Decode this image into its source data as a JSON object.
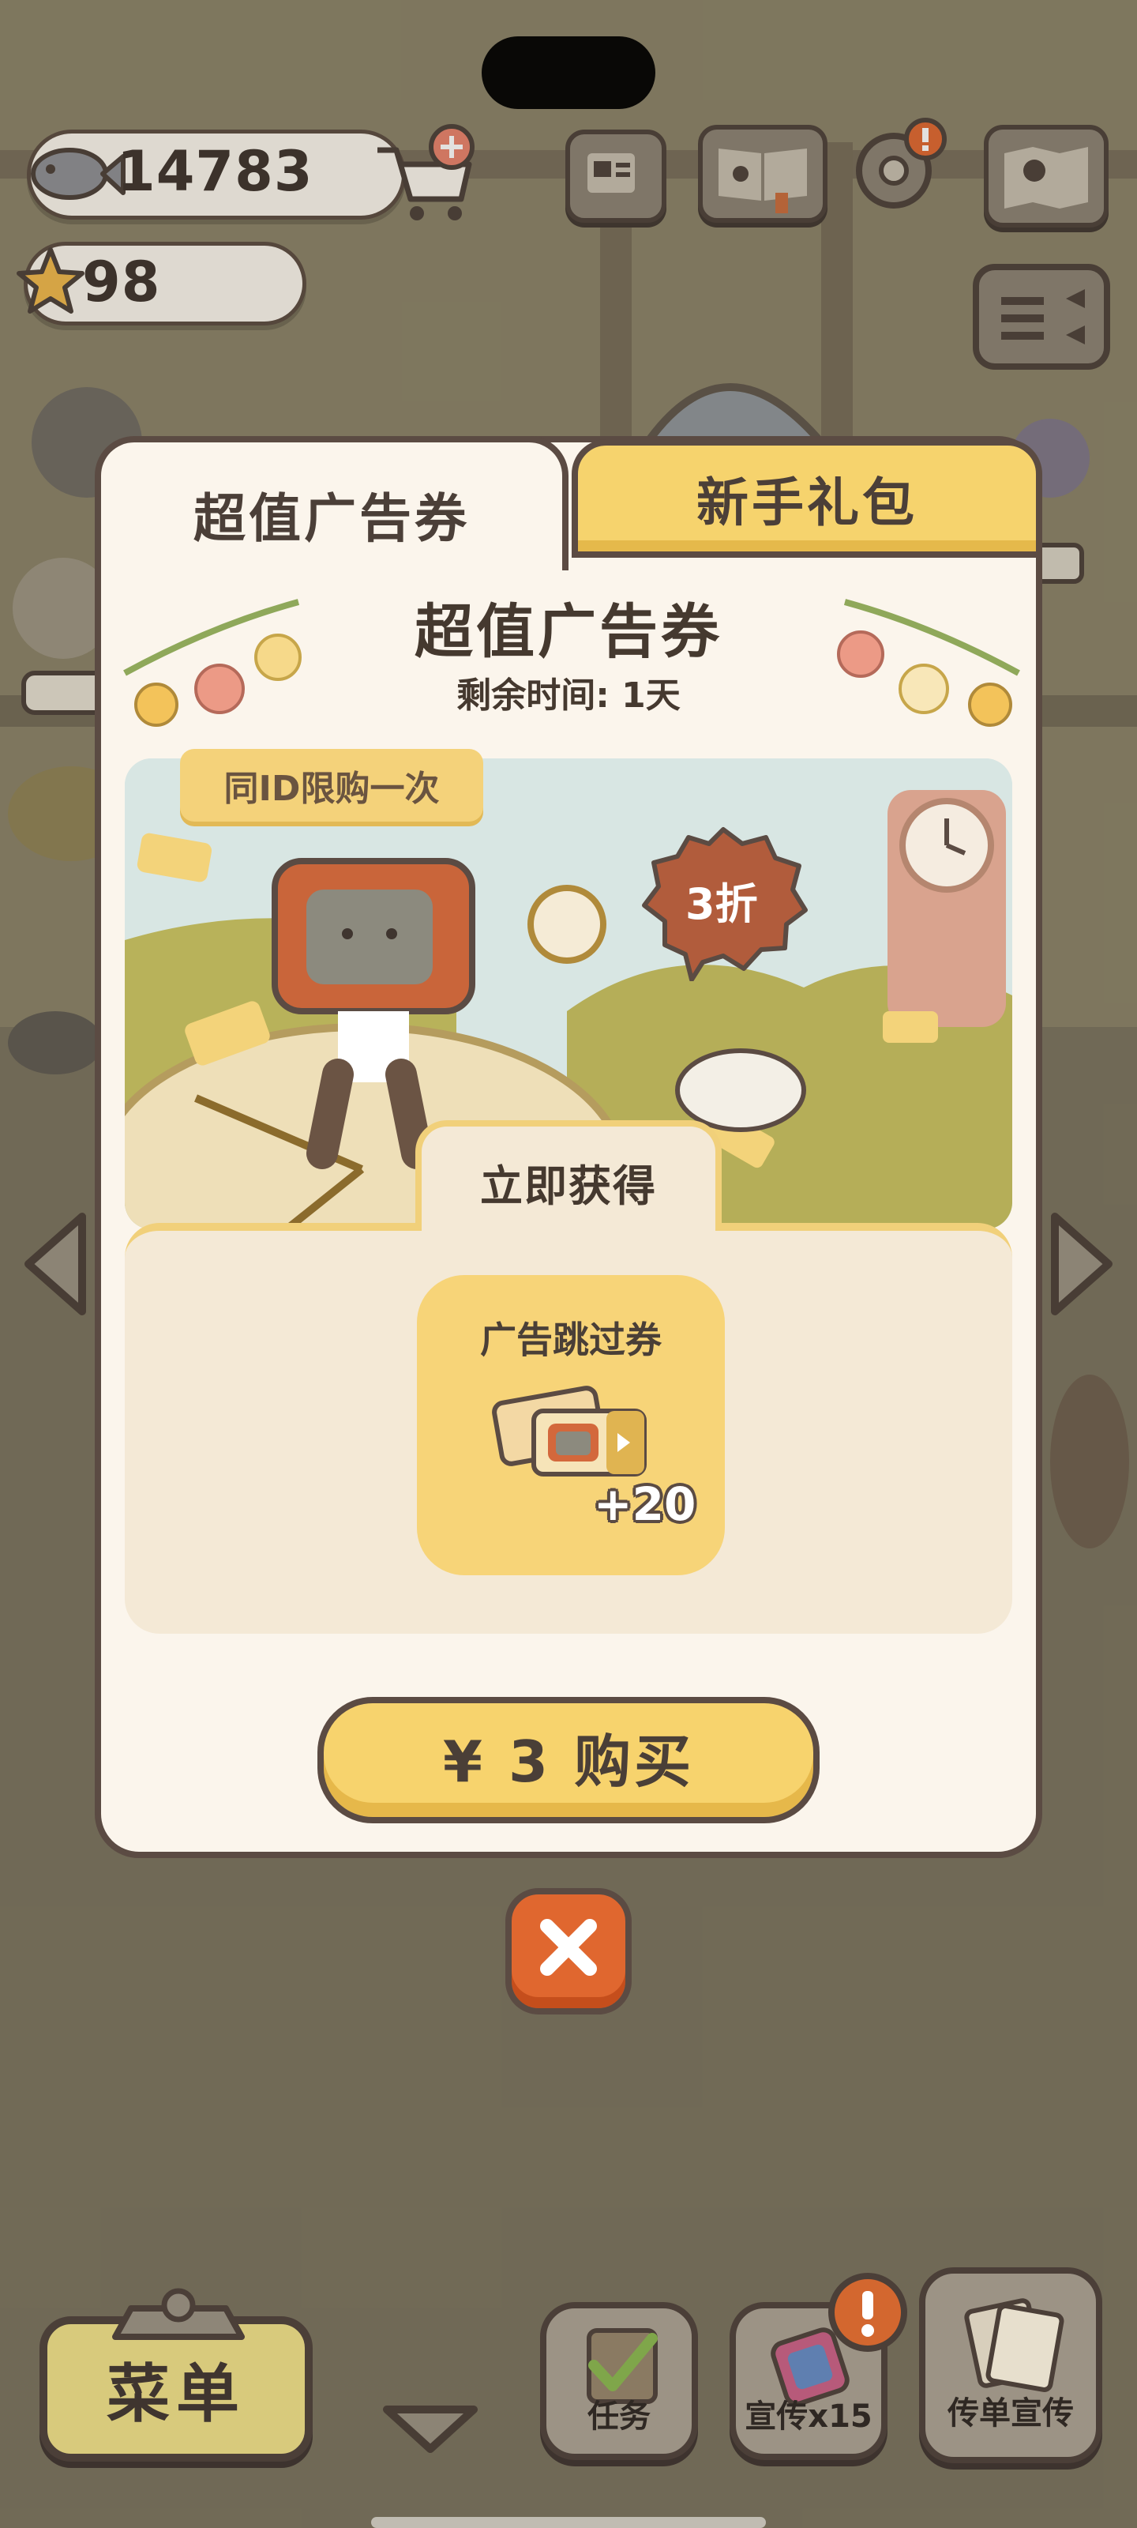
{
  "resources": {
    "fish_count": "14783",
    "star_count": "98"
  },
  "popup": {
    "tabs": [
      {
        "label": "超值广告券",
        "active": true
      },
      {
        "label": "新手礼包",
        "active": false
      }
    ],
    "title": "超值广告券",
    "remaining_time": "剩余时间: 1天",
    "limit_tag": "同ID限购一次",
    "discount_badge": "3折",
    "get_now_label": "立即获得",
    "reward": {
      "name": "广告跳过券",
      "count": "+20",
      "icon": "ad-skip-ticket-icon"
    },
    "buy_button": "¥ 3 购买"
  },
  "bottom_bar": {
    "menu_label": "菜单",
    "tasks_label": "任务",
    "promo_label": "宣传x15",
    "flyer_label": "传单宣传"
  },
  "colors": {
    "accent_yellow": "#f7d36d",
    "close_orange": "#e0672f",
    "outline": "#5b4b43",
    "panel_cream": "#fbf5ec"
  }
}
